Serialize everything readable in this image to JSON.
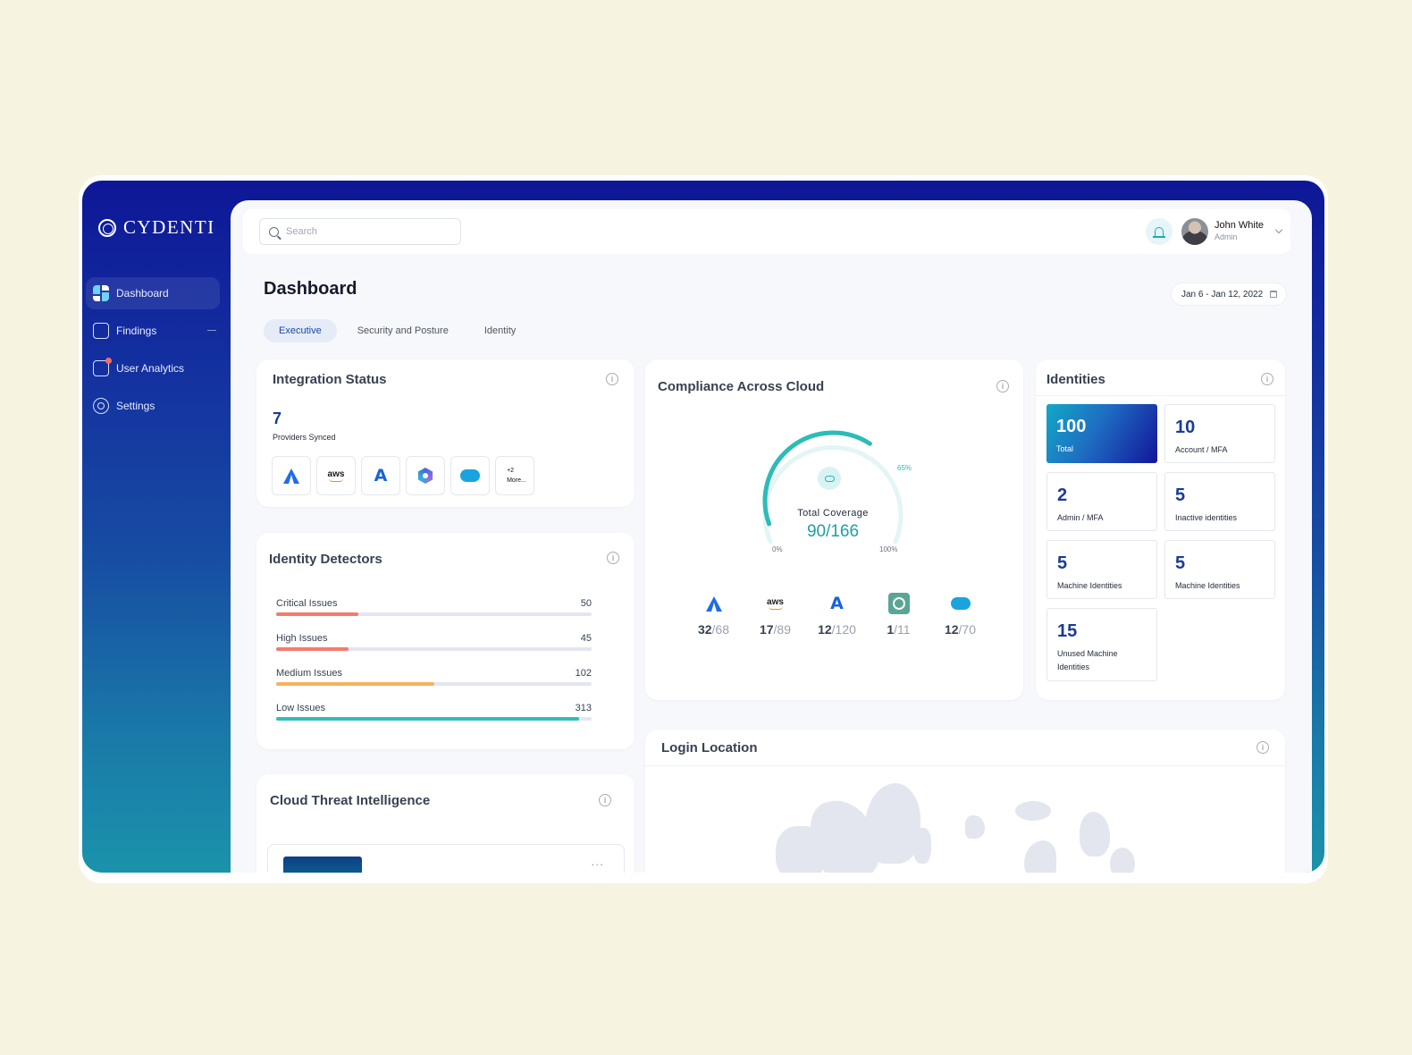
{
  "app": {
    "brand": "CYDENTI"
  },
  "sidebar": {
    "items": [
      {
        "label": "Dashboard",
        "icon": "dashboard-icon"
      },
      {
        "label": "Findings",
        "icon": "findings-icon"
      },
      {
        "label": "User Analytics",
        "icon": "analytics-icon"
      },
      {
        "label": "Settings",
        "icon": "gear-icon"
      }
    ]
  },
  "topbar": {
    "search_placeholder": "Search",
    "user": {
      "name": "John White",
      "role": "Admin"
    }
  },
  "page": {
    "title": "Dashboard",
    "date_range": "Jan 6 - Jan 12, 2022",
    "tabs": [
      "Executive",
      "Security and Posture",
      "Identity"
    ]
  },
  "integration": {
    "title": "Integration Status",
    "count": "7",
    "subtitle": "Providers Synced",
    "providers": [
      "atlassian",
      "aws",
      "azure",
      "hexagon",
      "salesforce"
    ],
    "more_count": "+2",
    "more_label": "More..."
  },
  "detectors": {
    "title": "Identity Detectors",
    "issues": [
      {
        "label": "Critical Issues",
        "value": "50",
        "fraction": 0.26,
        "color": "#f47b6e"
      },
      {
        "label": "High Issues",
        "value": "45",
        "fraction": 0.23,
        "color": "#f47b6e"
      },
      {
        "label": "Medium Issues",
        "value": "102",
        "fraction": 0.5,
        "color": "#f6b15f"
      },
      {
        "label": "Low Issues",
        "value": "313",
        "fraction": 0.96,
        "color": "#32bdb5"
      }
    ]
  },
  "threat": {
    "title": "Cloud Threat Intelligence",
    "more_icon": "..."
  },
  "compliance": {
    "title": "Compliance Across Cloud",
    "gauge_label": "Total Coverage",
    "gauge_value": "90/166",
    "gauge_percent": "65%",
    "gauge_fraction": 0.65,
    "gauge_min": "0%",
    "gauge_max": "100%",
    "clouds": [
      {
        "logo": "atlassian",
        "num": "32",
        "den": "/68"
      },
      {
        "logo": "aws",
        "num": "17",
        "den": "/89"
      },
      {
        "logo": "azure",
        "num": "12",
        "den": "/120"
      },
      {
        "logo": "ring",
        "num": "1",
        "den": "/11"
      },
      {
        "logo": "salesforce",
        "num": "12",
        "den": "/70"
      }
    ]
  },
  "identities": {
    "title": "Identities",
    "tiles": [
      {
        "value": "100",
        "label": "Total"
      },
      {
        "value": "10",
        "label": "Account / MFA"
      },
      {
        "value": "2",
        "label": "Admin / MFA"
      },
      {
        "value": "5",
        "label": "Inactive identities"
      },
      {
        "value": "5",
        "label": "Machine Identities"
      },
      {
        "value": "5",
        "label": "Machine Identities"
      },
      {
        "value": "15",
        "label": "Unused Machine Identities"
      }
    ]
  },
  "login": {
    "title": "Login Location"
  },
  "logo_text": {
    "aws": "aws",
    "azure": "A",
    "info": "i"
  },
  "colors": {
    "accent": "#1a47a6",
    "teal": "#2cbcb8",
    "brand_dark": "#0e1797"
  }
}
